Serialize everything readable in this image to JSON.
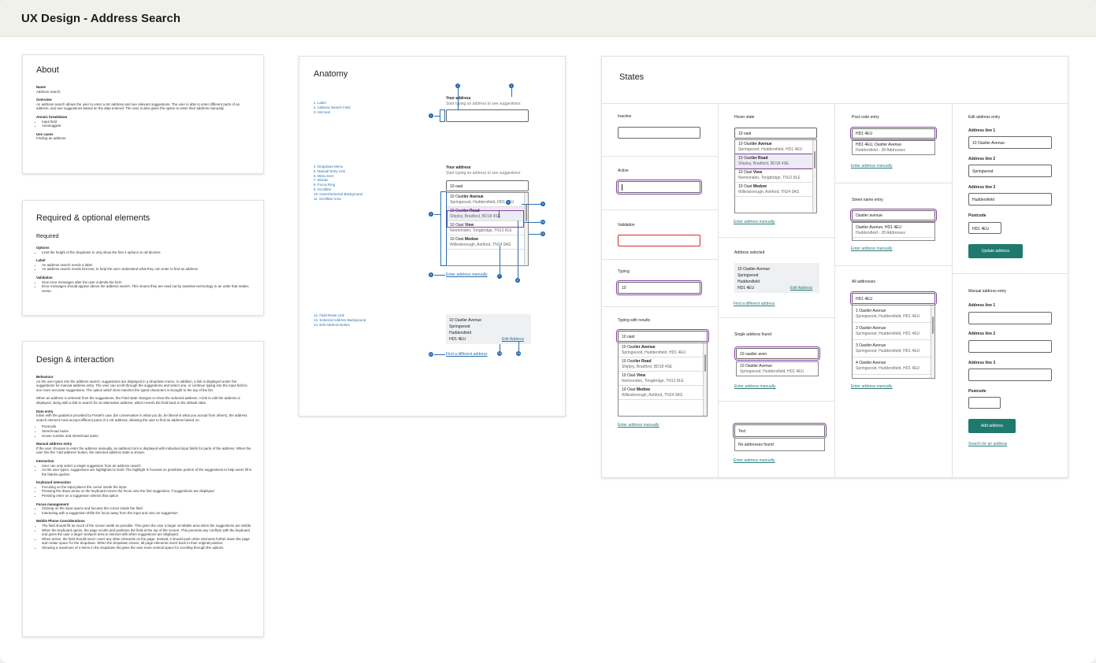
{
  "page_title": "UX Design - Address Search",
  "about": {
    "title": "About",
    "name_h": "Name",
    "name": "Address search",
    "overview_h": "Overview",
    "overview": "An address search allows the user to enter a UK address and see relevant suggestions. The user is able to enter different parts of an address, and see suggestions based on the data entered. The user is also given the option to enter their address manually.",
    "atomic_h": "Atomic breakdown",
    "atomic": [
      "Input field",
      "Autosuggest"
    ],
    "use_h": "Use cases",
    "use": "Finding an address"
  },
  "required": {
    "title": "Required & optional elements",
    "sub": "Required",
    "options_h": "Options",
    "options": [
      "Limit the height of the dropdown to only show the first 4 options on all devices"
    ],
    "label_h": "Label",
    "label": [
      "An address search needs a label",
      "An address search needs hint text, to help the user understand what they can enter to find an address"
    ],
    "validation_h": "Validation",
    "validation": [
      "Give error messages after the user submits the form",
      "Error messages should appear above the address search. This means they are read out by assistive technology in an order that makes sense."
    ]
  },
  "design": {
    "title": "Design & interaction",
    "behaviour_h": "Behaviour",
    "behaviour1": "As the user types into the address search, suggestions are displayed in a dropdown menu. In addition, a link is displayed under the suggestions for manual address entry. The user can scroll through the suggestions and select one, or continue typing into the input field to see more accurate suggestions. The option which best matches the typed characters is brought to the top of the list.",
    "behaviour2": "When an address is selected from the suggestions, the Field state changes to show the selected address. A link to edit the address is displayed, along with a link to search for an alternative address, which reverts the field back to the default state.",
    "data_h": "Data entry",
    "data": "Inline with the guidance provided by Postel's Law. (be conservative in what you do, be liberal in what you accept from others), the address search element must accept different parts of a UK address, allowing the user to find an address based on:",
    "data_list": [
      "Postcode",
      "Street/road name",
      "House number and street/road name"
    ],
    "manual_h": "Manual address entry",
    "manual": "If the user chooses to enter the address manually, an address form is displayed with individual input fields for parts of the address. When the user hits the 'Add address' button, the selected address state is shown.",
    "interaction_h": "Interaction",
    "interaction": [
      "User can only select a single suggestion from an address search",
      "As the user types, suggestions are highlighted in bold. The highlight is focused on predictive portion of the suggestions to help users fill in the blanks quicker."
    ],
    "keyboard_h": "Keyboard interaction",
    "keyboard": [
      "Focusing on the input places the cursor inside the input",
      "Pressing the down arrow on the keyboard moves the focus onto the first suggestion, if suggestions are displayed",
      "Pressing enter on a suggestion selects that option"
    ],
    "focus_h": "Focus management",
    "focus": [
      "Clicking on the input opens and focuses the cursor inside the field",
      "Interacting with a suggestion shifts the focus away from the input and onto an suggestion"
    ],
    "mobile_h": "Mobile Phone Considerations",
    "mobile": [
      "The field should fill as much of the screen width as possible. This gives the user a larger scrollable area when the suggestions are visible.",
      "When the keyboard opens, the page scrolls and positions the field at the top of the screen. This prevents any conflicts with the keyboard and gives the user a larger viewport area to interact with when suggestions are displayed.",
      "When active, the field should never cover any other elements on the page. Instead, it should push other elements further down the page and create space for the dropdown. When the dropdown closes, all page elements revert back to their original position.",
      "Showing a maximum of 4 items in the dropdown list gives the user more vertical space for scrolling through the options."
    ]
  },
  "anatomy": {
    "title": "Anatomy",
    "legend1": [
      "1. Label",
      "2. Address Search Field",
      "3. Hint text"
    ],
    "legend2": [
      "4. Dropdown Menu",
      "5. Manual Entry Link",
      "6. Menu Item",
      "7. Divider",
      "8. Focus Ring",
      "9. Scrollbar",
      "10. Hover/Selected Background",
      "11. Scrollbar Area"
    ],
    "legend3": [
      "12. Field Reset Link",
      "13. Selected Address Background",
      "14. Edit Address Button"
    ],
    "label": "Your address",
    "hint": "Start typing an address to see suggestions",
    "typed": "10 oast",
    "manual_link": "Enter address manually",
    "reset_link": "Find a different address",
    "edit_link": "Edit Address",
    "pins": [
      "1",
      "2",
      "3",
      "4",
      "5",
      "6",
      "7",
      "8",
      "9",
      "10",
      "11",
      "12",
      "13",
      "14"
    ]
  },
  "suggestions": [
    {
      "pre": "10 Oast",
      "bold": "ler Avenue",
      "sub": "Springwood, Huddersfield, HD1 4EU"
    },
    {
      "pre": "10 Oast",
      "bold": "ler Road",
      "sub": "Shipley, Bradford, BD18 4SE"
    },
    {
      "pre": "10 Oast ",
      "bold": "View",
      "sub": "Normonden, Tongbridge, TN12 8LE"
    },
    {
      "pre": "10 Oast ",
      "bold": "Medow",
      "sub": "Willesborough, Ashford, TN24 0AS"
    }
  ],
  "selected_address": [
    "10 Oastler Avenue",
    "Springwood",
    "Huddersfield",
    "HD1 4EU"
  ],
  "states": {
    "title": "States",
    "inactive": "Inactive",
    "active": "Active",
    "validation": "Validation",
    "typing": "Typing",
    "typing_value": "10",
    "typing_results": "Typing with results",
    "typed": "10 oast",
    "manual_link": "Enter address manually",
    "hover": "Hover state",
    "address_selected": "Address selected",
    "edit_link": "Edit Address",
    "different_link": "Find a different address",
    "single_found": "Single address found",
    "single_value": "10 oastler aven",
    "single_sugg_a": "10 Oastler Avenue",
    "single_sugg_b": "Springwood, Huddersfield, HD1 4EU",
    "no_value": "Test",
    "no_found": "No addresses found",
    "postcode_entry": "Post code entry",
    "postcode_value": "HD1 4EU",
    "postcode_sugg_a": "HD1 4EU, Oastler Avenue",
    "postcode_sugg_b": "Huddersfield - 28 Addresses",
    "street_entry": "Street name entry",
    "street_value": "Oastler avenue",
    "street_sugg_a": "Oastler Avenue, HD1 4EU",
    "street_sugg_b": "Huddersfield - 28 Addresses",
    "all_addresses": "All addresses",
    "all_value": "HD1 4EU",
    "all_list": [
      {
        "a": "1 Oastler Avenue",
        "b": "Springwood, Huddersfield, HD1 4EU"
      },
      {
        "a": "2 Oastler Avenue",
        "b": "Springwood, Huddersfield, HD1 4EU"
      },
      {
        "a": "3 Oastler Avenue",
        "b": "Springwood, Huddersfield, HD1 4EU"
      },
      {
        "a": "4 Oastler Avenue",
        "b": "Springwood, Huddersfield, HD1 4EU"
      }
    ],
    "edit_entry": "Edit address entry",
    "line1": "Address line 1",
    "line2": "Address line 2",
    "line3": "Address line 3",
    "postcode": "Postcode",
    "edit_v1": "10 Oastler Avenue",
    "edit_v2": "Springwood",
    "edit_v3": "Huddersfield",
    "edit_v4": "HD1 4EU",
    "update_btn": "Update address",
    "manual_entry": "Manual address entry",
    "add_btn": "Add address",
    "search_link": "Search for an address"
  },
  "colors": {
    "accent": "#1f7a6e",
    "focus": "#8b3ea8",
    "error": "#d42a2a",
    "link": "#2a6fb0"
  }
}
